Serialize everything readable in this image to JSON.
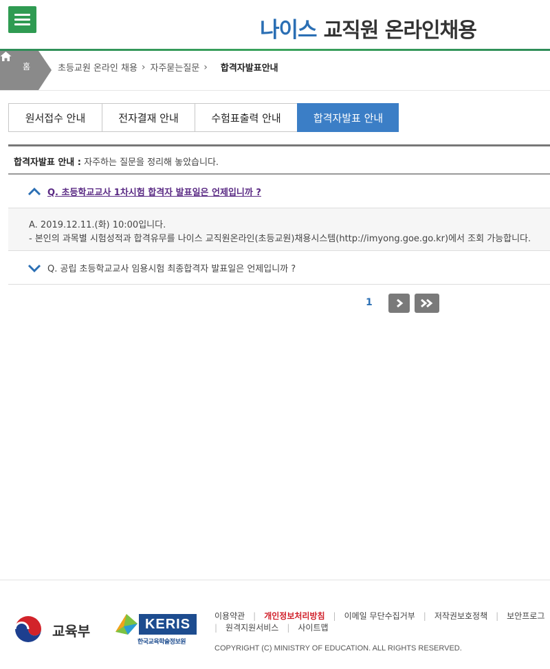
{
  "header": {
    "brand_neis": "나이스",
    "brand_title": "교직원 온라인채용"
  },
  "breadcrumb": {
    "home": "홈",
    "items": [
      "초등교원 온라인 채용",
      "자주묻는질문"
    ],
    "current": "합격자발표안내"
  },
  "tabs": [
    {
      "label": "원서접수 안내",
      "active": false
    },
    {
      "label": "전자결재 안내",
      "active": false
    },
    {
      "label": "수험표출력 안내",
      "active": false
    },
    {
      "label": "합격자발표 안내",
      "active": true
    }
  ],
  "intro": {
    "title": "합격자발표 안내 :",
    "text": "자주하는 질문을 정리해 놓았습니다."
  },
  "faq": [
    {
      "question": "Q. 초등학교교사 1차시험 합격자 발표일은 언제입니까 ?",
      "open": true,
      "answer_lines": [
        "A. 2019.12.11.(화) 10:00입니다.",
        "- 본인의 과목별 시험성적과 합격유무를 나이스 교직원온라인(초등교원)채용시스템(http://imyong.goe.go.kr)에서 조회 가능합니다."
      ]
    },
    {
      "question": "Q. 공립 초등학교교사 임용시험 최종합격자 발표일은 언제입니까 ?",
      "open": false
    }
  ],
  "pagination": {
    "current_page": "1",
    "next_label": "›",
    "last_label": "»"
  },
  "footer": {
    "moe_name": "교육부",
    "keris_name": "KERIS",
    "keris_sub": "한국교육학술정보원",
    "links_row1": [
      "이용약관",
      "개인정보처리방침",
      "이메일 무단수집거부",
      "저작권보호정책",
      "보안프로그"
    ],
    "links_row2": [
      "원격지원서비스",
      "사이트맵"
    ],
    "copyright": "COPYRIGHT (C) MINISTRY OF EDUCATION. ALL RIGHTS RESERVED."
  },
  "colors": {
    "accent_green": "#2f9b52",
    "accent_blue": "#3b7ec6",
    "privacy_red": "#d01e28",
    "question_purple": "#5a2a84"
  }
}
